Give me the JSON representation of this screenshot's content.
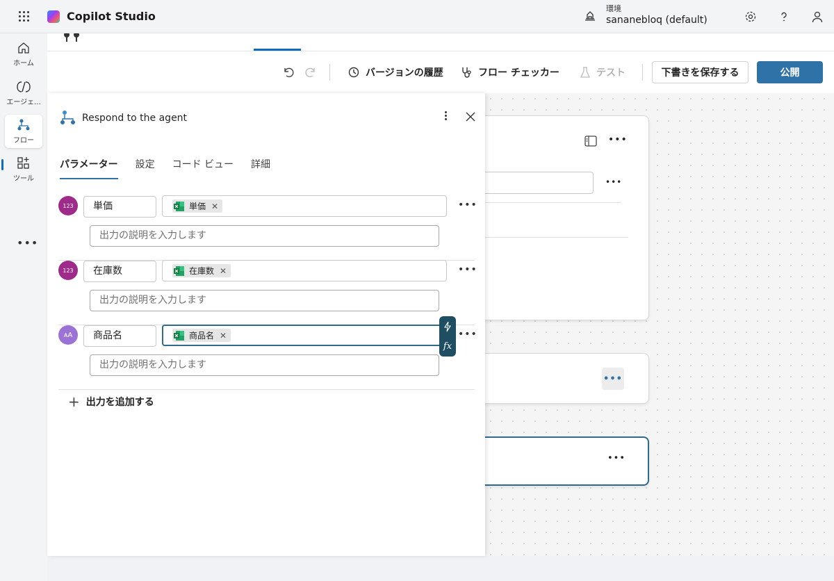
{
  "app": {
    "title": "Copilot Studio"
  },
  "environment": {
    "label": "環境",
    "value": "sananebloq (default)"
  },
  "rail": {
    "items": [
      {
        "label": "ホーム",
        "icon": "home-icon"
      },
      {
        "label": "エージェ...",
        "icon": "agent-icon"
      },
      {
        "label": "フロー",
        "icon": "flow-icon"
      },
      {
        "label": "ツール",
        "icon": "tools-icon"
      }
    ],
    "more": "•••"
  },
  "toolbar": {
    "version_history": "バージョンの履歴",
    "flow_checker": "フロー チェッカー",
    "test": "テスト",
    "save_draft": "下書きを保存する",
    "publish": "公開"
  },
  "panel": {
    "title": "Respond to the agent",
    "tabs": [
      "パラメーター",
      "設定",
      "コード ビュー",
      "詳細"
    ],
    "parameters": [
      {
        "name": "単価",
        "type": "number",
        "chip": "単価",
        "description_placeholder": "出力の説明を入力します"
      },
      {
        "name": "在庫数",
        "type": "number",
        "chip": "在庫数",
        "description_placeholder": "出力の説明を入力します"
      },
      {
        "name": "商品名",
        "type": "text",
        "chip": "商品名",
        "description_placeholder": "出力の説明を入力します"
      }
    ],
    "add_output": "出力を追加する",
    "fx_icons": [
      "lightning-icon",
      "fx-icon"
    ]
  },
  "colors": {
    "accent": "#2e72a8",
    "number_badge": "#9e2a8a",
    "text_badge": "#9b73d6"
  }
}
